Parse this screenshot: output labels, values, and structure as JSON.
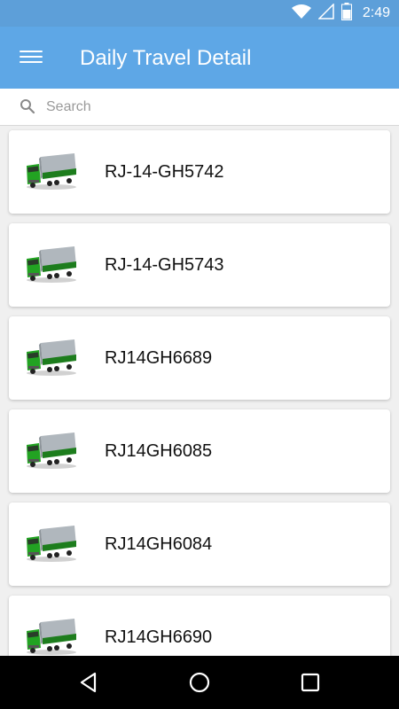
{
  "status_bar": {
    "time": "2:49",
    "icons": [
      "wifi-icon",
      "signal-icon",
      "battery-icon"
    ]
  },
  "app_bar": {
    "title": "Daily Travel Detail",
    "menu_icon": "menu-icon"
  },
  "search": {
    "placeholder": "Search",
    "value": "",
    "icon": "search-icon"
  },
  "vehicles": [
    {
      "number": "RJ-14-GH5742",
      "icon": "truck-icon"
    },
    {
      "number": "RJ-14-GH5743",
      "icon": "truck-icon"
    },
    {
      "number": "RJ14GH6689",
      "icon": "truck-icon"
    },
    {
      "number": "RJ14GH6085",
      "icon": "truck-icon"
    },
    {
      "number": "RJ14GH6084",
      "icon": "truck-icon"
    },
    {
      "number": "RJ14GH6690",
      "icon": "truck-icon"
    }
  ],
  "nav_bar": {
    "buttons": [
      "back-icon",
      "home-icon",
      "recents-icon"
    ]
  },
  "colors": {
    "app_bar": "#5ea7e6",
    "status_bar": "#5d9fd9",
    "truck_cab": "#1f9a1f",
    "truck_container": "#a9b0b6"
  }
}
